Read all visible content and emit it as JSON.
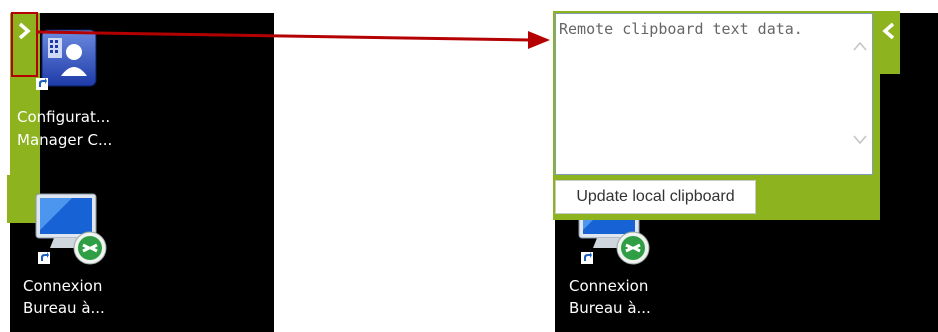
{
  "left_desktop": {
    "config_manager": {
      "icon": "configuration-manager-icon",
      "label_line1": "Configurat...",
      "label_line2": "Manager C..."
    },
    "rdp": {
      "icon": "remote-desktop-icon",
      "label_line1": "Connexion",
      "label_line2": "Bureau à..."
    },
    "sidebar_toggle_icon": "chevron-right-icon"
  },
  "right_desktop": {
    "clipboard_panel": {
      "textarea_value": "Remote clipboard text data.",
      "button_label": "Update local clipboard",
      "collapse_icon": "chevron-left-icon"
    },
    "rdp": {
      "icon": "remote-desktop-icon",
      "label_line1": "Connexion",
      "label_line2": "Bureau à..."
    }
  },
  "colors": {
    "accent_green": "#8db41f",
    "highlight_red": "#b40000",
    "desktop_bg": "#000000"
  }
}
